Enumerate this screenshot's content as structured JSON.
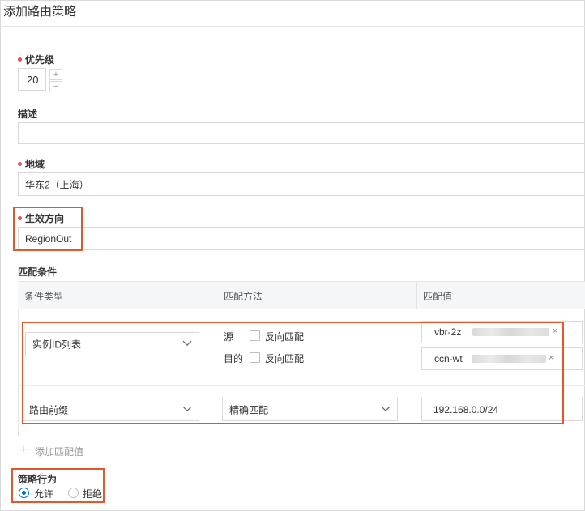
{
  "dialog": {
    "title": "添加路由策略"
  },
  "priority": {
    "label": "优先级",
    "value": "20",
    "increment": "+",
    "decrement": "−"
  },
  "description": {
    "label": "描述",
    "value": ""
  },
  "region": {
    "label": "地域",
    "value": "华东2（上海）"
  },
  "direction": {
    "label": "生效方向",
    "value": "RegionOut"
  },
  "match": {
    "label": "匹配条件",
    "columns": [
      "条件类型",
      "匹配方法",
      "匹配值"
    ],
    "rows": [
      {
        "type": "实例ID列表",
        "methods": [
          {
            "name": "源",
            "checkbox_label": "反向匹配"
          },
          {
            "name": "目的",
            "checkbox_label": "反向匹配"
          }
        ],
        "values": [
          "vbr-2z",
          "ccn-wt"
        ]
      },
      {
        "type": "路由前缀",
        "method": "精确匹配",
        "value": "192.168.0.0/24"
      }
    ],
    "add_label": "添加匹配值",
    "add_icon": "+"
  },
  "action": {
    "label": "策略行为",
    "options": [
      {
        "label": "允许",
        "checked": true
      },
      {
        "label": "拒绝",
        "checked": false
      }
    ]
  },
  "icons": {
    "remove": "×"
  },
  "colors": {
    "accent": "#0070cc",
    "highlight": "#e4572e",
    "required": "#e5534b"
  }
}
